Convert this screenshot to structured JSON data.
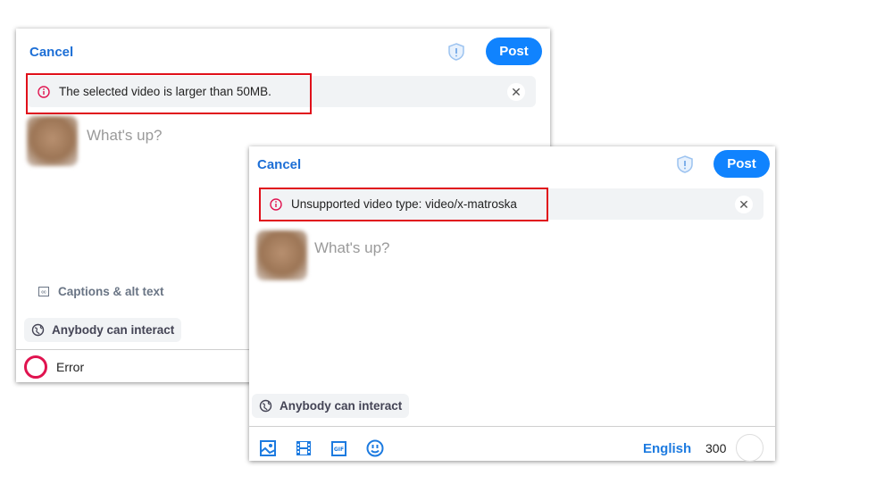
{
  "dialogs": [
    {
      "cancel_label": "Cancel",
      "post_label": "Post",
      "alert_text": "The selected video is larger than 50MB.",
      "placeholder": "What's up?",
      "captions_label": "Captions & alt text",
      "interaction_label": "Anybody can interact",
      "status_label": "Error"
    },
    {
      "cancel_label": "Cancel",
      "post_label": "Post",
      "alert_text": "Unsupported video type: video/x-matroska",
      "placeholder": "What's up?",
      "interaction_label": "Anybody can interact",
      "language_label": "English",
      "char_count": "300"
    }
  ],
  "colors": {
    "accent": "#1083fe",
    "error": "#e0134f",
    "highlight_box": "#e0101a"
  }
}
